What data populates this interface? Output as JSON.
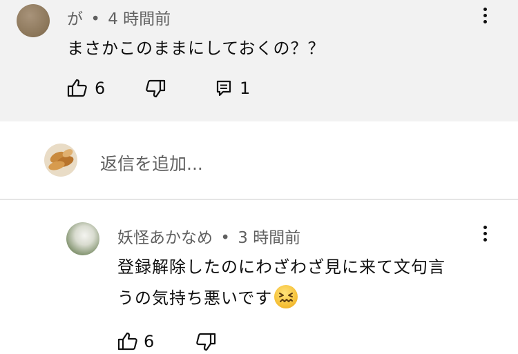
{
  "comment": {
    "author": "が",
    "separator": "•",
    "time": "4 時間前",
    "text": "まさかこのままにしておくの？？",
    "likes": "6",
    "replies": "1"
  },
  "reply_box": {
    "placeholder": "返信を追加..."
  },
  "reply": {
    "author": "妖怪あかなめ",
    "separator": "•",
    "time": "3 時間前",
    "text_line1": "登録解除したのにわざわざ見に来て文句言",
    "text_line2": "うの気持ち悪いです",
    "emoji": "confounded-face-emoji",
    "likes": "6"
  },
  "colors": {
    "top_background": "#f2f2f2",
    "meta_text": "#606060"
  }
}
